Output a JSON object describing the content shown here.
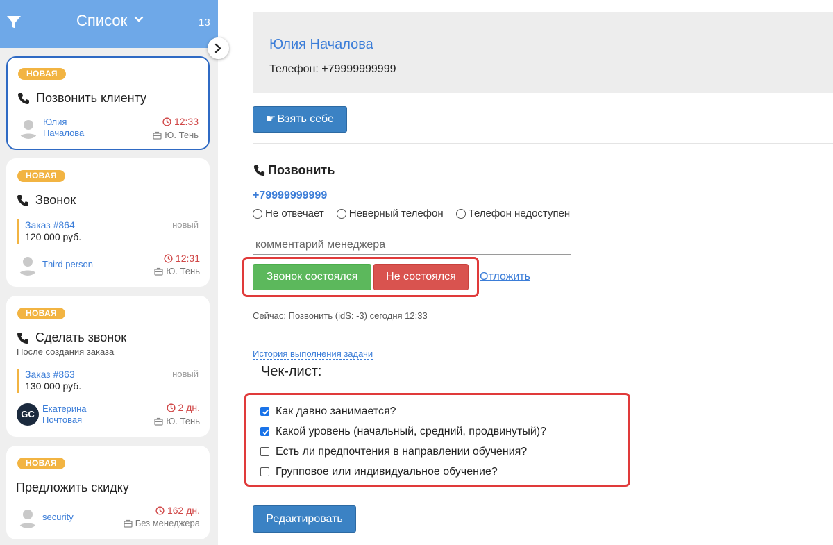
{
  "sidebar": {
    "title": "Список",
    "count": "13",
    "cards": [
      {
        "badge": "НОВАЯ",
        "title": "Позвонить клиенту",
        "person": "Юлия Началова",
        "time": "12:33",
        "manager": "Ю. Тень"
      },
      {
        "badge": "НОВАЯ",
        "title": "Звонок",
        "order_link": "Заказ #864",
        "order_sum": "120 000 руб.",
        "order_status": "новый",
        "person": "Third person",
        "time": "12:31",
        "manager": "Ю. Тень"
      },
      {
        "badge": "НОВАЯ",
        "title": "Сделать звонок",
        "subtitle": "После создания заказа",
        "order_link": "Заказ #863",
        "order_sum": "130 000 руб.",
        "order_status": "новый",
        "person": "Екатерина Почтовая",
        "avatar_initials": "GC",
        "time": "2 дн.",
        "manager": "Ю. Тень"
      },
      {
        "badge": "НОВАЯ",
        "title": "Предложить скидку",
        "person": "security",
        "time": "162 дн.",
        "manager": "Без менеджера"
      }
    ]
  },
  "contact": {
    "name": "Юлия Началова",
    "phone_label": "Телефон: +79999999999"
  },
  "take_button": "Взять себе",
  "call": {
    "title": "Позвонить",
    "phone": "+79999999999",
    "radios": [
      "Не отвечает",
      "Неверный телефон",
      "Телефон недоступен"
    ],
    "comment_placeholder": "комментарий менеджера",
    "success_button": "Звонок состоялся",
    "fail_button": "Не состоялся",
    "postpone_link": "Отложить",
    "now_text": "Сейчас: Позвонить (idS: -3) сегодня 12:33"
  },
  "history_link": "История выполнения задачи",
  "checklist": {
    "title": "Чек-лист:",
    "items": [
      {
        "label": "Как давно занимается?",
        "checked": true
      },
      {
        "label": "Какой уровень (начальный, средний, продвинутый)?",
        "checked": true
      },
      {
        "label": "Есть ли предпочтения в направлении обучения?",
        "checked": false
      },
      {
        "label": "Групповое или индивидуальное обучение?",
        "checked": false
      }
    ]
  },
  "edit_button": "Редактировать",
  "colors": {
    "header_blue": "#6ea8e8",
    "badge_orange": "#f2b442",
    "link_blue": "#3b7dd8",
    "time_red": "#d04747",
    "success_green": "#5cb85c",
    "fail_red": "#d9534f",
    "highlight_red": "#e03a3a"
  }
}
